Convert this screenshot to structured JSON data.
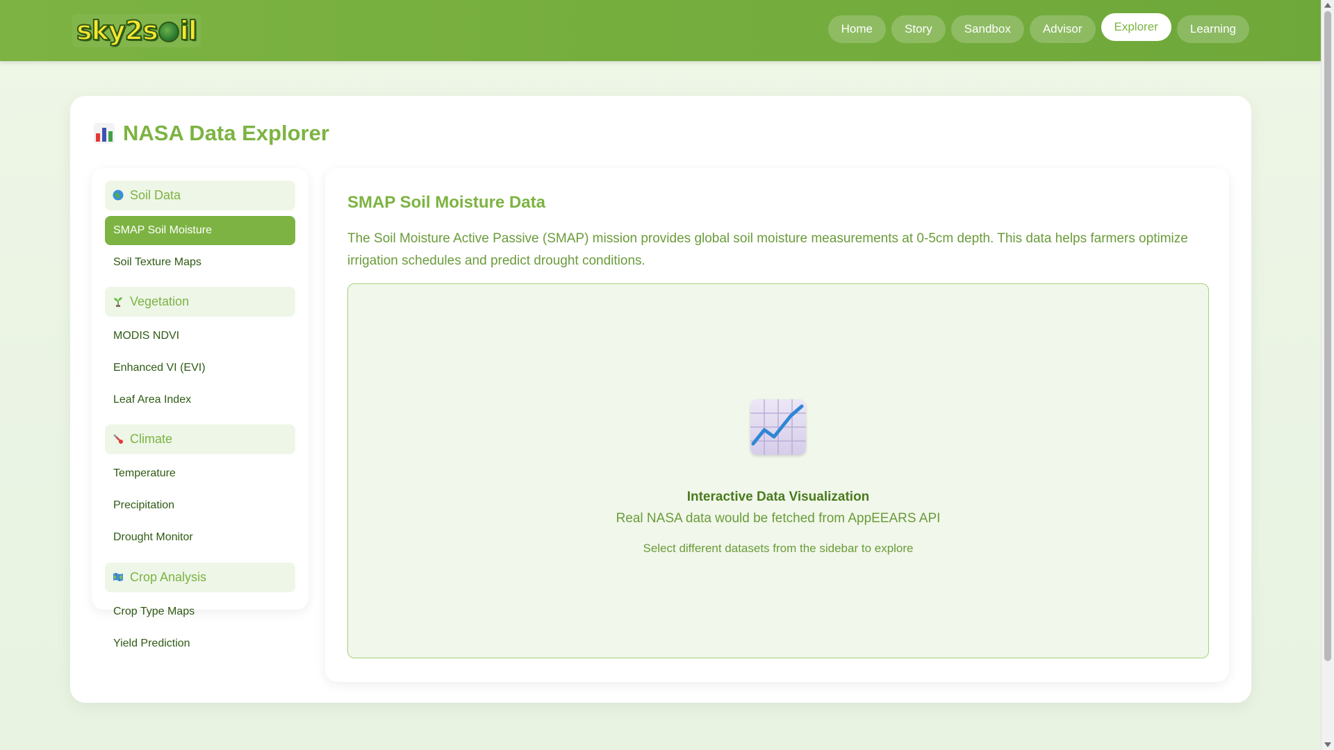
{
  "header": {
    "logo_text": "sky2soil",
    "nav": [
      {
        "label": "Home",
        "active": false
      },
      {
        "label": "Story",
        "active": false
      },
      {
        "label": "Sandbox",
        "active": false
      },
      {
        "label": "Advisor",
        "active": false
      },
      {
        "label": "Explorer",
        "active": true
      },
      {
        "label": "Learning",
        "active": false
      }
    ]
  },
  "page": {
    "title": "NASA Data Explorer",
    "title_icon": "bar-chart-icon"
  },
  "sidebar": {
    "sections": [
      {
        "label": "Soil Data",
        "icon": "globe-icon",
        "items": [
          "SMAP Soil Moisture",
          "Soil Texture Maps"
        ]
      },
      {
        "label": "Vegetation",
        "icon": "seedling-icon",
        "items": [
          "MODIS NDVI",
          "Enhanced VI (EVI)",
          "Leaf Area Index"
        ]
      },
      {
        "label": "Climate",
        "icon": "thermometer-icon",
        "items": [
          "Temperature",
          "Precipitation",
          "Drought Monitor"
        ]
      },
      {
        "label": "Crop Analysis",
        "icon": "map-icon",
        "items": [
          "Crop Type Maps",
          "Yield Prediction"
        ]
      }
    ],
    "active_item": "SMAP Soil Moisture"
  },
  "content": {
    "title": "SMAP Soil Moisture Data",
    "description": "The Soil Moisture Active Passive (SMAP) mission provides global soil moisture measurements at 0-5cm depth. This data helps farmers optimize irrigation schedules and predict drought conditions.",
    "viz": {
      "icon": "chart-increasing-icon",
      "title": "Interactive Data Visualization",
      "subtitle": "Real NASA data would be fetched from AppEEARS API",
      "hint": "Select different datasets from the sidebar to explore"
    }
  },
  "colors": {
    "brand_green": "#7cb342",
    "dark_green": "#2f5a14",
    "logo_yellow": "#f7e531"
  }
}
